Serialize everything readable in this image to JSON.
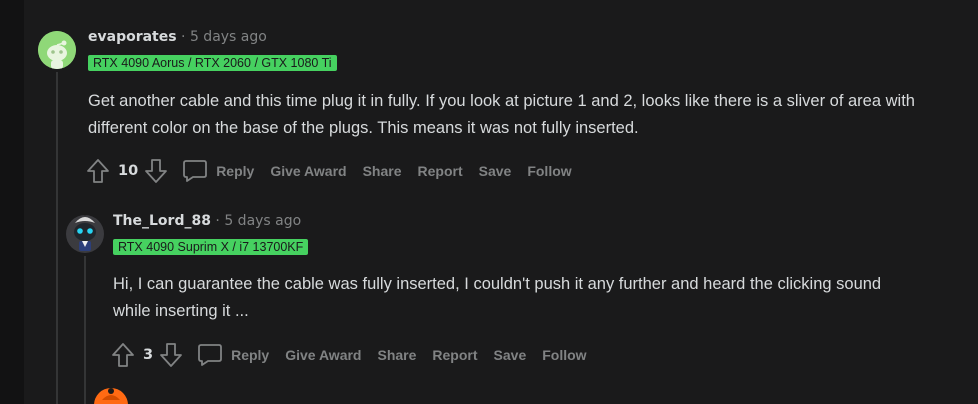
{
  "comments": [
    {
      "author": "evaporates",
      "separator": "·",
      "time": "5 days ago",
      "flair": "RTX 4090 Aorus / RTX 2060 / GTX 1080 Ti",
      "body": "Get another cable and this time plug it in fully. If you look at picture 1 and 2, looks like there is a sliver of area with different color on the base of the plugs. This means it was not fully inserted.",
      "votes": "10",
      "actions": {
        "reply": "Reply",
        "give_award": "Give Award",
        "share": "Share",
        "report": "Report",
        "save": "Save",
        "follow": "Follow"
      }
    },
    {
      "author": "The_Lord_88",
      "separator": "·",
      "time": "5 days ago",
      "flair": "RTX 4090 Suprim X / i7 13700KF",
      "body": "Hi, I can guarantee the cable was fully inserted, I couldn't push it any further and heard the clicking sound while inserting it ...",
      "votes": "3",
      "actions": {
        "reply": "Reply",
        "give_award": "Give Award",
        "share": "Share",
        "report": "Report",
        "save": "Save",
        "follow": "Follow"
      }
    }
  ],
  "colors": {
    "background": "#1a1a1b",
    "flair_bg": "#46d160",
    "text": "#d7dadc",
    "muted": "#818384"
  }
}
